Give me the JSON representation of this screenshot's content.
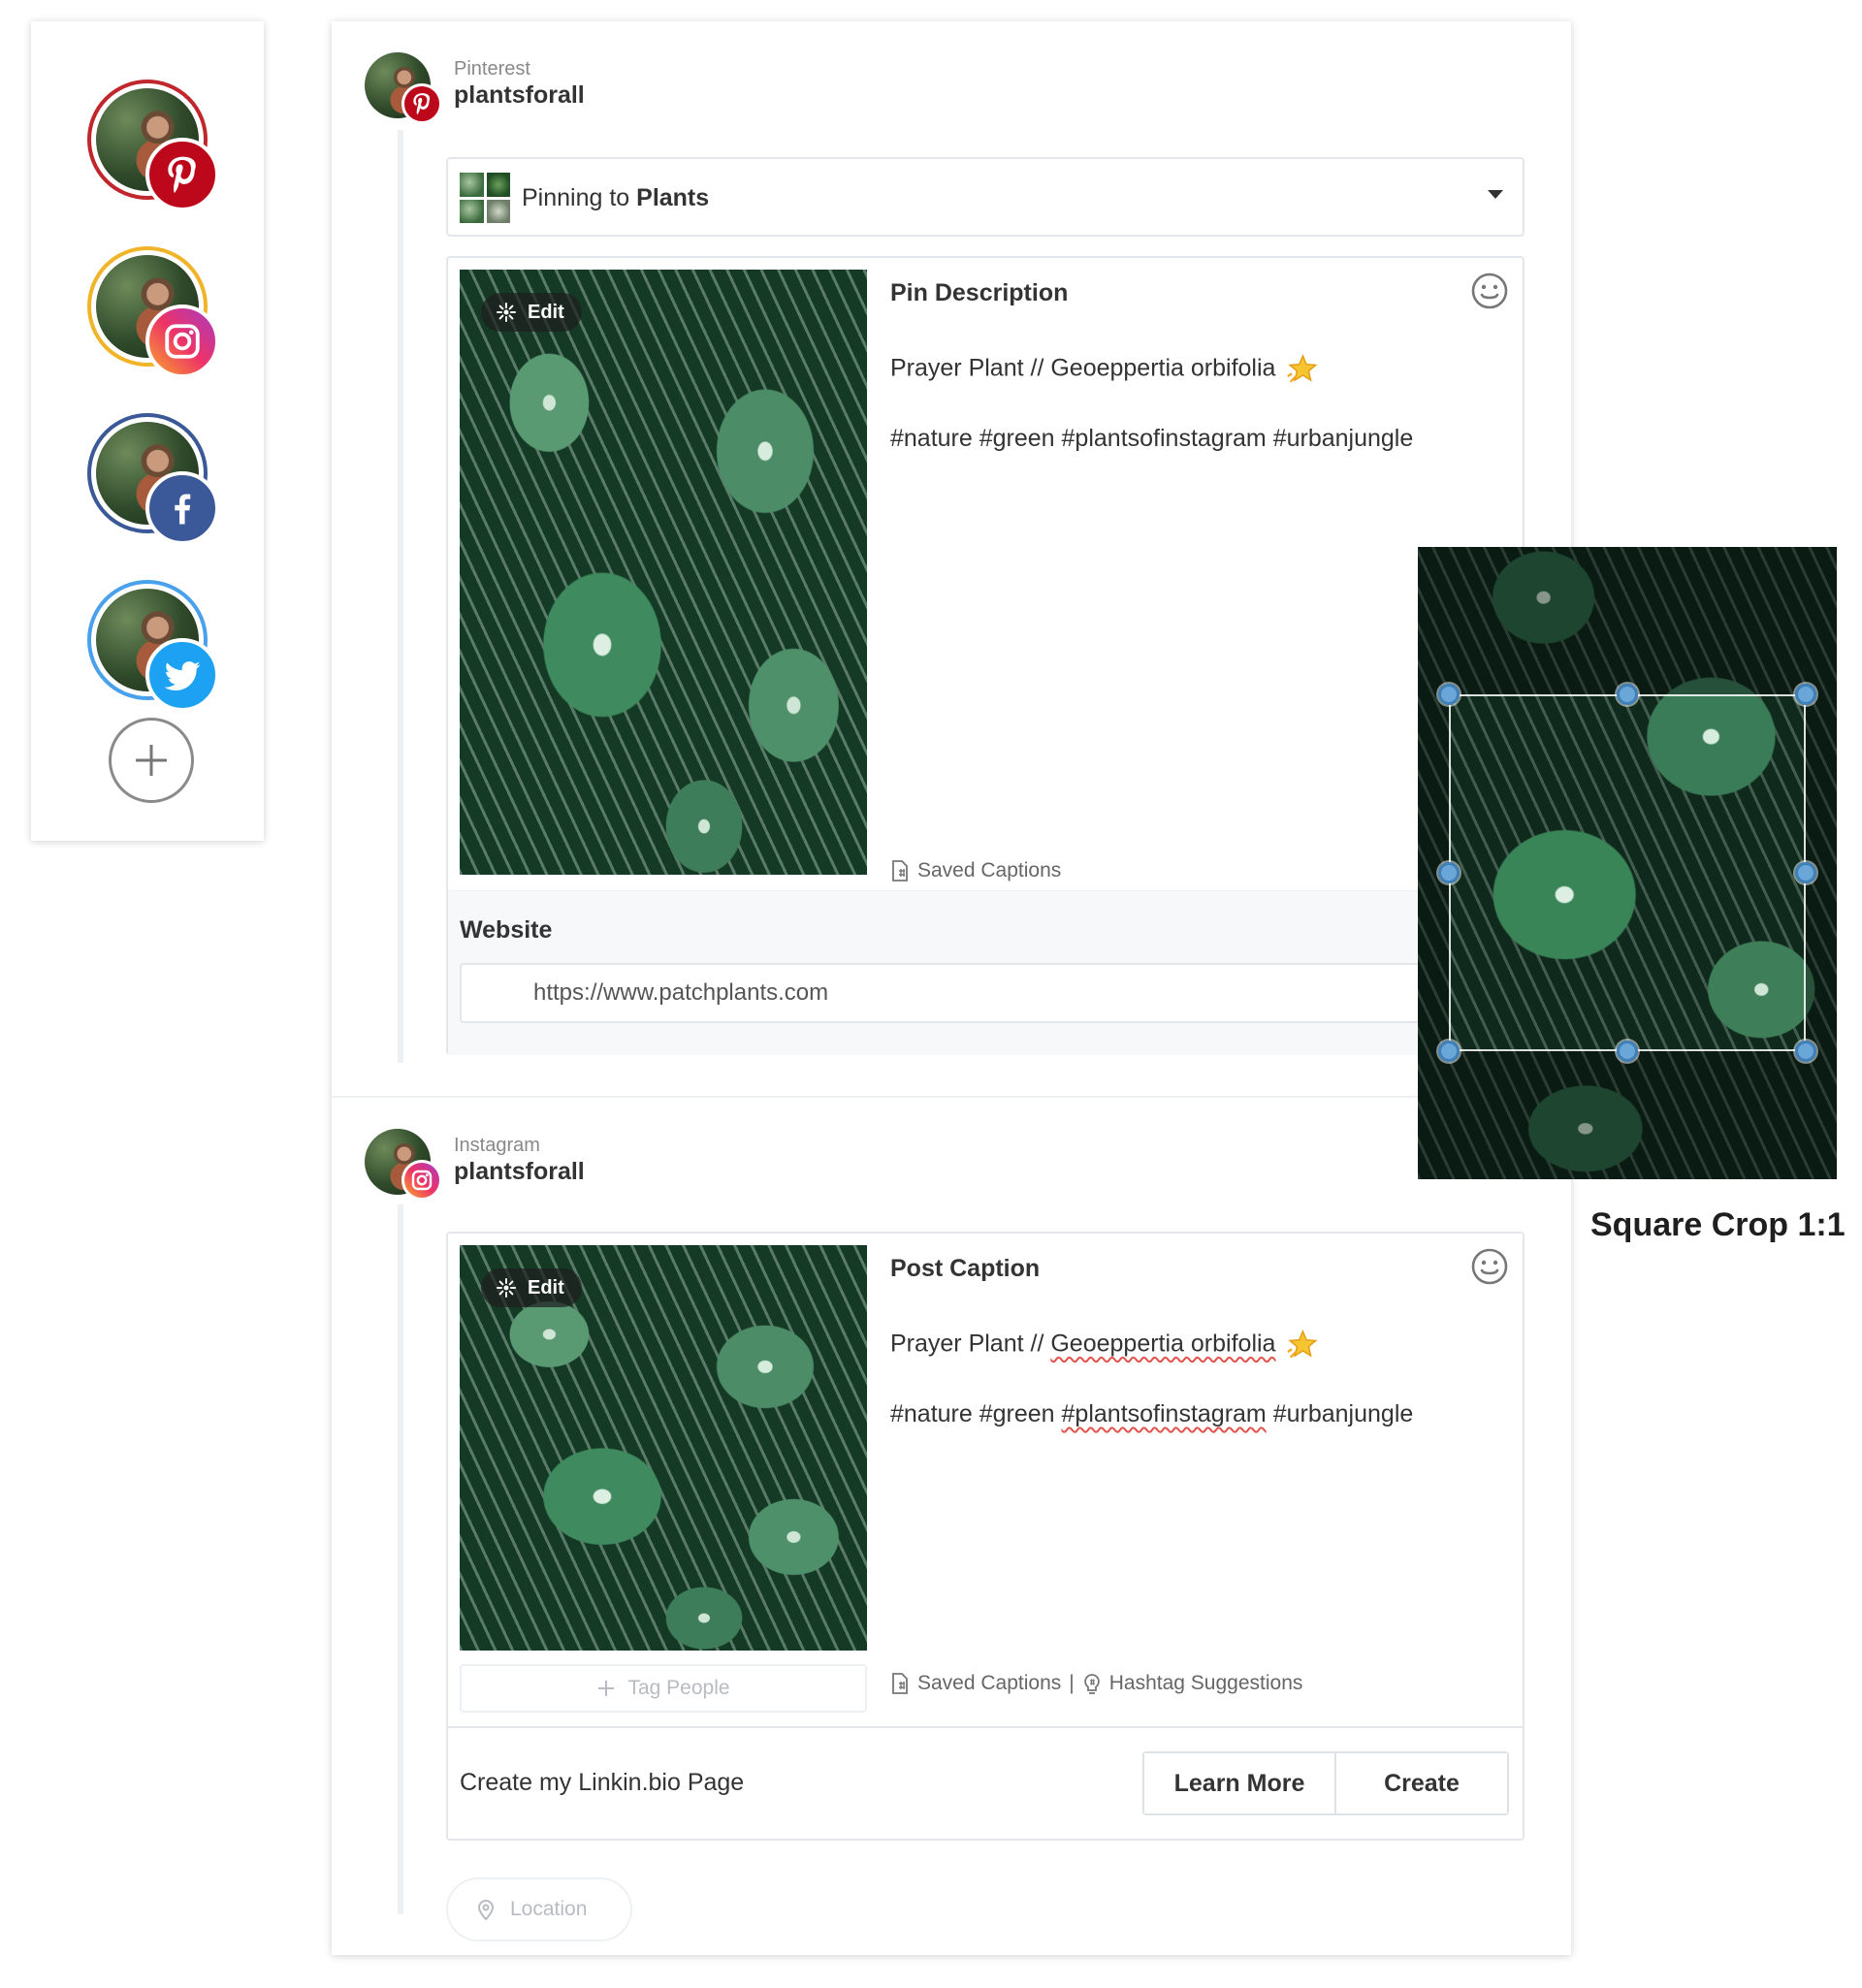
{
  "sidebar": {
    "accounts": [
      {
        "network": "pinterest",
        "icon": "pinterest-icon",
        "ring": "#c0272d"
      },
      {
        "network": "instagram",
        "icon": "instagram-icon",
        "ring": "#f0b429"
      },
      {
        "network": "facebook",
        "icon": "facebook-icon",
        "ring": "#3b5998"
      },
      {
        "network": "twitter",
        "icon": "twitter-icon",
        "ring": "#4aa1eb"
      }
    ],
    "add_icon": "plus-icon"
  },
  "pinterest_post": {
    "network_label": "Pinterest",
    "username": "plantsforall",
    "board_prefix": "Pinning to ",
    "board_name": "Plants",
    "description_title": "Pin Description",
    "caption_line1": "Prayer Plant // Geoeppertia orbifolia",
    "caption_line2": "#nature #green #plantsofinstagram #urbanjungle",
    "edit_label": "Edit",
    "saved_captions": "Saved Captions",
    "website_label": "Website",
    "website_value": "https://www.patchplants.com"
  },
  "instagram_post": {
    "network_label": "Instagram",
    "username": "plantsforall",
    "caption_title": "Post Caption",
    "caption_line1_a": "Prayer Plant // ",
    "caption_line1_b": "Geoeppertia orbifolia",
    "caption_line2_a": "#nature #green ",
    "caption_line2_b": "#plantsofinstagram",
    "caption_line2_c": " #urbanjungle",
    "edit_label": "Edit",
    "tag_people": "Tag People",
    "saved_captions": "Saved Captions",
    "separator": "|",
    "hashtag_suggestions": "Hashtag Suggestions",
    "linkin_text": "Create my Linkin.bio Page",
    "learn_more": "Learn More",
    "create": "Create",
    "location_placeholder": "Location"
  },
  "crop": {
    "label": "Square Crop 1:1"
  },
  "colors": {
    "pinterest": "#bd081c",
    "facebook": "#3b5998",
    "twitter": "#1da1f2",
    "border": "#e3e7eb",
    "handle": "#6aa6d8"
  }
}
